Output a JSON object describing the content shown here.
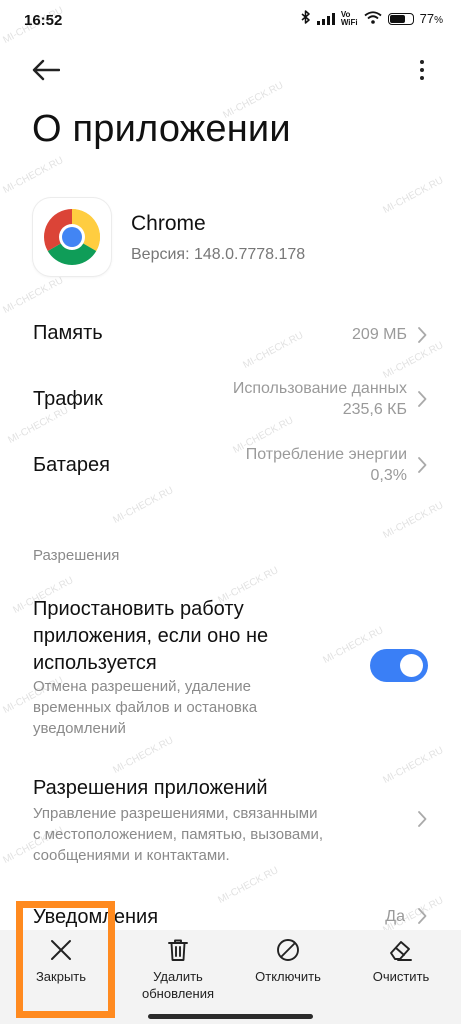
{
  "status_bar": {
    "time": "16:52",
    "vowifi_top": "Vo",
    "vowifi_bottom": "WiFi",
    "battery_percent": "77",
    "battery_level": 0.77,
    "icons": [
      "bluetooth-icon",
      "signal-icon",
      "vowifi-icon",
      "wifi-icon",
      "battery-icon"
    ]
  },
  "header": {
    "back_icon": "arrow-left-icon",
    "more_icon": "more-vertical-icon"
  },
  "page": {
    "title": "О приложении"
  },
  "app": {
    "name": "Chrome",
    "version": "Версия: 148.0.7778.178",
    "icon": "chrome-logo"
  },
  "rows": {
    "memory": {
      "label": "Память",
      "value": "209 МБ"
    },
    "traffic": {
      "label": "Трафик",
      "value_line1": "Использование данных",
      "value_line2": "235,6 КБ"
    },
    "battery": {
      "label": "Батарея",
      "value_line1": "Потребление энергии",
      "value_line2": "0,3%"
    }
  },
  "permissions": {
    "section_title": "Разрешения",
    "pause": {
      "title_line1": "Приостановить работу",
      "title_line2": "приложения, если оно не",
      "title_line3": "используется",
      "desc_line1": "Отмена разрешений, удаление",
      "desc_line2": "временных файлов и остановка",
      "desc_line3": "уведомлений",
      "enabled": true
    },
    "app_permissions": {
      "title": "Разрешения приложений",
      "desc_line1": "Управление разрешениями, связанными",
      "desc_line2": "с местоположением, памятью, вызовами,",
      "desc_line3": "сообщениями и контактами."
    },
    "notifications": {
      "label": "Уведомления",
      "value": "Да"
    }
  },
  "bottom_bar": {
    "close": {
      "label": "Закрыть",
      "icon": "close-icon"
    },
    "uninstall_updates": {
      "label_line1": "Удалить",
      "label_line2": "обновления",
      "icon": "trash-icon"
    },
    "disable": {
      "label": "Отключить",
      "icon": "disable-icon"
    },
    "clear": {
      "label": "Очистить",
      "icon": "eraser-icon"
    }
  },
  "watermark": "MI-CHECK.RU",
  "colors": {
    "accent": "#3a7ff6",
    "highlight": "#ff8a1f",
    "secondary_text": "#8a8a8a",
    "bottom_bar_bg": "#f3f3f3"
  }
}
